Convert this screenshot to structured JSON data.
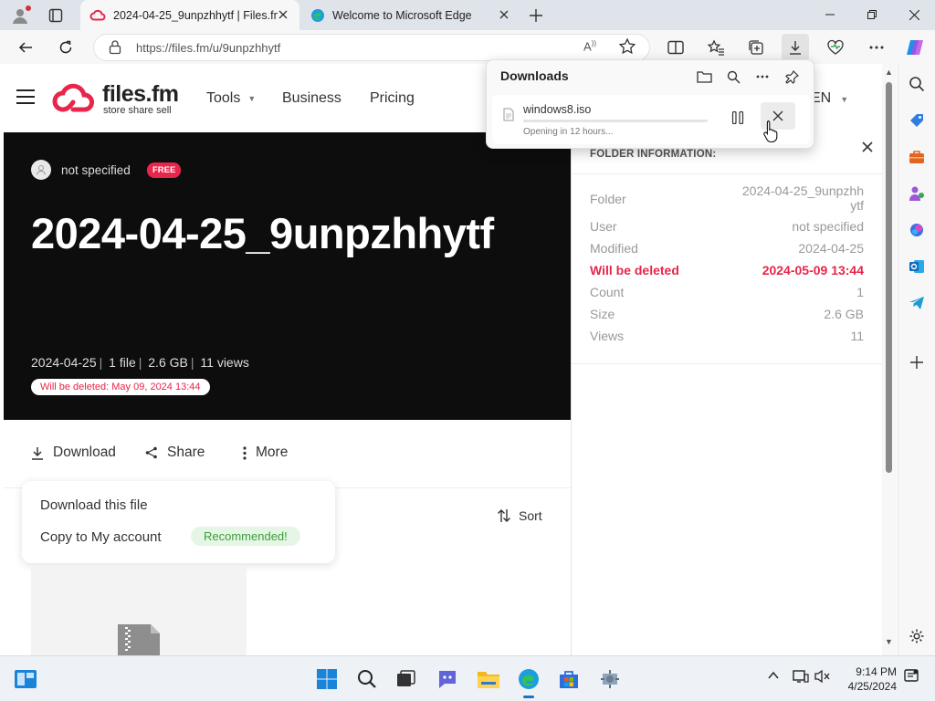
{
  "browser": {
    "tabs": [
      {
        "title": "2024-04-25_9unpzhhytf | Files.fm",
        "active": true
      },
      {
        "title": "Welcome to Microsoft Edge",
        "active": false
      }
    ],
    "address": "https://files.fm/u/9unpzhhytf"
  },
  "site": {
    "logo_name": "files.fm",
    "logo_tagline": "store share sell",
    "nav": {
      "tools": "Tools",
      "business": "Business",
      "pricing": "Pricing"
    },
    "language": "EN"
  },
  "hero": {
    "owner": "not specified",
    "plan_badge": "FREE",
    "title": "2024-04-25_9unpzhhytf",
    "meta": {
      "date": "2024-04-25",
      "files": "1 file",
      "size": "2.6 GB",
      "views": "11 views"
    },
    "deletion_notice": "Will be deleted: May 09, 2024 13:44"
  },
  "actions": {
    "download": "Download",
    "share": "Share",
    "more": "More"
  },
  "download_menu": {
    "download_file": "Download this file",
    "copy_account": "Copy to My account",
    "recommended": "Recommended!"
  },
  "sort_label": "Sort",
  "folder_info": {
    "heading": "FOLDER INFORMATION:",
    "rows": [
      {
        "key": "Folder",
        "value": "2024-04-25_9unpzhhytf"
      },
      {
        "key": "User",
        "value": "not specified"
      },
      {
        "key": "Modified",
        "value": "2024-04-25"
      },
      {
        "key": "Will be deleted",
        "value": "2024-05-09 13:44"
      },
      {
        "key": "Count",
        "value": "1"
      },
      {
        "key": "Size",
        "value": "2.6 GB"
      },
      {
        "key": "Views",
        "value": "11"
      }
    ]
  },
  "downloads": {
    "title": "Downloads",
    "item": {
      "filename": "windows8.iso",
      "status": "Opening in 12 hours...",
      "progress": 0.0
    }
  },
  "taskbar": {
    "time": "9:14 PM",
    "date": "4/25/2024"
  },
  "colors": {
    "brand_red": "#e8254a",
    "hero_bg": "#0d0d0d",
    "edge_blue": "#0f6cbd"
  }
}
